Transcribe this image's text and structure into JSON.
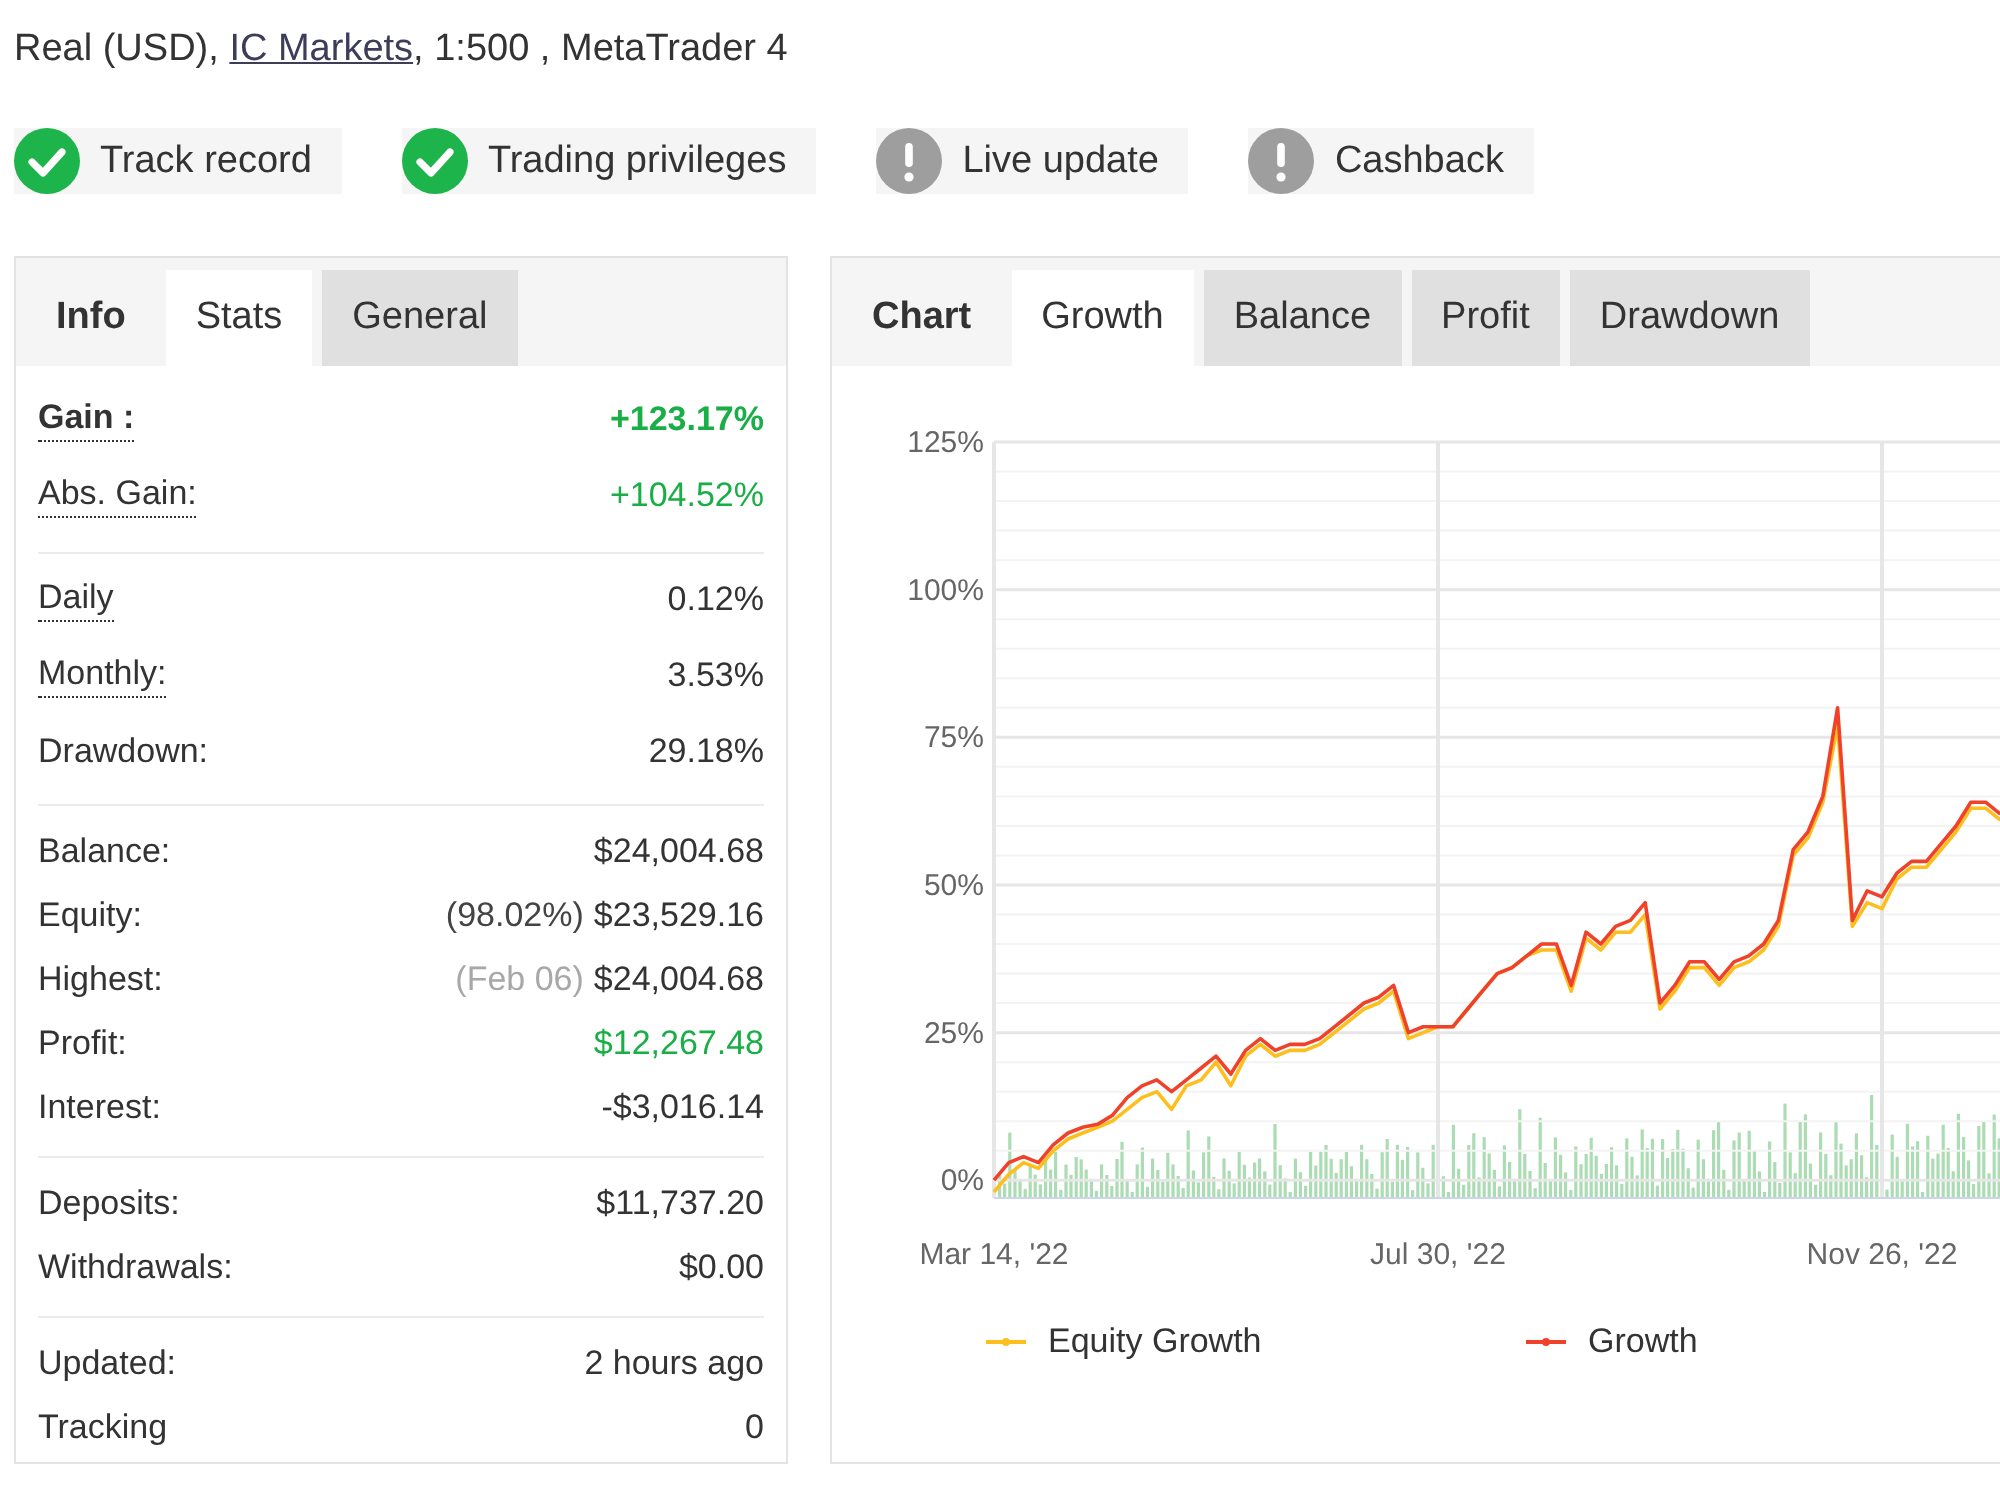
{
  "account_line": {
    "prefix": "Real (USD), ",
    "link": "IC Markets",
    "suffix": ", 1:500 , MetaTrader 4"
  },
  "badges": [
    {
      "label": "Track record",
      "verified": true
    },
    {
      "label": "Trading privileges",
      "verified": true
    },
    {
      "label": "Live update",
      "verified": false
    },
    {
      "label": "Cashback",
      "verified": false
    }
  ],
  "stats_panel": {
    "heading": "Info",
    "tabs": [
      {
        "label": "Stats",
        "selected": true
      },
      {
        "label": "General",
        "selected": false
      }
    ],
    "groups": [
      {
        "rows": [
          {
            "label": "Gain :",
            "value": "+123.17%",
            "tooltip": true,
            "emphasis": true,
            "positive": true
          },
          {
            "label": "Abs. Gain:",
            "value": "+104.52%",
            "tooltip": true,
            "emphasis": false,
            "positive": true
          }
        ]
      },
      {
        "rows": [
          {
            "label": "Daily",
            "value": "0.12%",
            "tooltip": true,
            "emphasis": false,
            "positive": false
          },
          {
            "label": "Monthly:",
            "value": "3.53%",
            "tooltip": true,
            "emphasis": false,
            "positive": false
          },
          {
            "label": "Drawdown:",
            "value": "29.18%",
            "tooltip": false,
            "emphasis": false,
            "positive": false
          }
        ]
      },
      {
        "rows": [
          {
            "label": "Balance:",
            "value": "$24,004.68",
            "tooltip": false,
            "emphasis": false,
            "positive": false
          },
          {
            "label": "Equity:",
            "note": "(98.02%)",
            "note_muted": false,
            "value": "$23,529.16",
            "tooltip": false,
            "emphasis": false,
            "positive": false
          },
          {
            "label": "Highest:",
            "note": "(Feb 06)",
            "note_muted": true,
            "value": "$24,004.68",
            "tooltip": false,
            "emphasis": false,
            "positive": false
          },
          {
            "label": "Profit:",
            "value": "$12,267.48",
            "tooltip": false,
            "emphasis": false,
            "positive": true
          },
          {
            "label": "Interest:",
            "value": "-$3,016.14",
            "tooltip": false,
            "emphasis": false,
            "positive": false
          }
        ]
      },
      {
        "rows": [
          {
            "label": "Deposits:",
            "value": "$11,737.20",
            "tooltip": false,
            "emphasis": false,
            "positive": false
          },
          {
            "label": "Withdrawals:",
            "value": "$0.00",
            "tooltip": false,
            "emphasis": false,
            "positive": false
          }
        ]
      },
      {
        "rows": [
          {
            "label": "Updated:",
            "value": "2 hours ago",
            "tooltip": false,
            "emphasis": false,
            "positive": false
          },
          {
            "label": "Tracking",
            "value": "0",
            "tooltip": false,
            "emphasis": false,
            "positive": false
          }
        ]
      }
    ]
  },
  "chart_panel": {
    "heading": "Chart",
    "tabs": [
      {
        "label": "Growth",
        "selected": true
      },
      {
        "label": "Balance",
        "selected": false
      },
      {
        "label": "Profit",
        "selected": false
      },
      {
        "label": "Drawdown",
        "selected": false
      }
    ],
    "chart_data": {
      "type": "line",
      "categories": [
        "Mar 14, '22",
        null,
        null,
        null,
        null,
        null,
        null,
        null,
        null,
        null,
        null,
        null,
        null,
        null,
        null,
        null,
        null,
        null,
        null,
        null,
        null,
        null,
        null,
        null,
        null,
        null,
        null,
        null,
        null,
        null,
        "Jul 30, '22",
        null,
        null,
        null,
        null,
        null,
        null,
        null,
        null,
        null,
        null,
        null,
        null,
        null,
        null,
        null,
        null,
        null,
        null,
        null,
        null,
        null,
        null,
        null,
        null,
        null,
        null,
        null,
        null,
        null,
        "Nov 26, '22",
        null,
        null,
        null,
        null,
        null,
        null,
        null,
        null
      ],
      "ylim": [
        -3,
        125
      ],
      "yticks": [
        {
          "value": 0,
          "label": "0%"
        },
        {
          "value": 25,
          "label": "25%"
        },
        {
          "value": 50,
          "label": "50%"
        },
        {
          "value": 75,
          "label": "75%"
        },
        {
          "value": 100,
          "label": "100%"
        },
        {
          "value": 125,
          "label": "125%"
        }
      ],
      "grid": true,
      "legend": "bottom",
      "series": [
        {
          "name": "Equity Growth",
          "color": "#fcbf1e",
          "values": [
            -2,
            1,
            3,
            2,
            5,
            7,
            8,
            9,
            10,
            12,
            14,
            15,
            12,
            16,
            17,
            20,
            16,
            21,
            23,
            21,
            22,
            22,
            23,
            25,
            27,
            29,
            30,
            32,
            24,
            25,
            26,
            26,
            29,
            32,
            35,
            36,
            38,
            39,
            39,
            32,
            41,
            39,
            42,
            42,
            45,
            29,
            32,
            36,
            36,
            33,
            36,
            37,
            39,
            43,
            55,
            58,
            64,
            77,
            43,
            47,
            46,
            51,
            53,
            53,
            56,
            59,
            63,
            63,
            61
          ]
        },
        {
          "name": "Growth",
          "color": "#f0422b",
          "values": [
            0,
            3,
            4,
            3,
            6,
            8,
            9,
            9.5,
            11,
            14,
            16,
            17,
            15,
            17,
            19,
            21,
            18,
            22,
            24,
            22,
            23,
            23,
            24,
            26,
            28,
            30,
            31,
            33,
            25,
            26,
            26,
            26,
            29,
            32,
            35,
            36,
            38,
            40,
            40,
            33,
            42,
            40,
            43,
            44,
            47,
            30,
            33,
            37,
            37,
            34,
            37,
            38,
            40,
            44,
            56,
            59,
            65,
            80,
            44,
            49,
            48,
            52,
            54,
            54,
            57,
            60,
            64,
            64,
            62
          ]
        }
      ]
    }
  }
}
